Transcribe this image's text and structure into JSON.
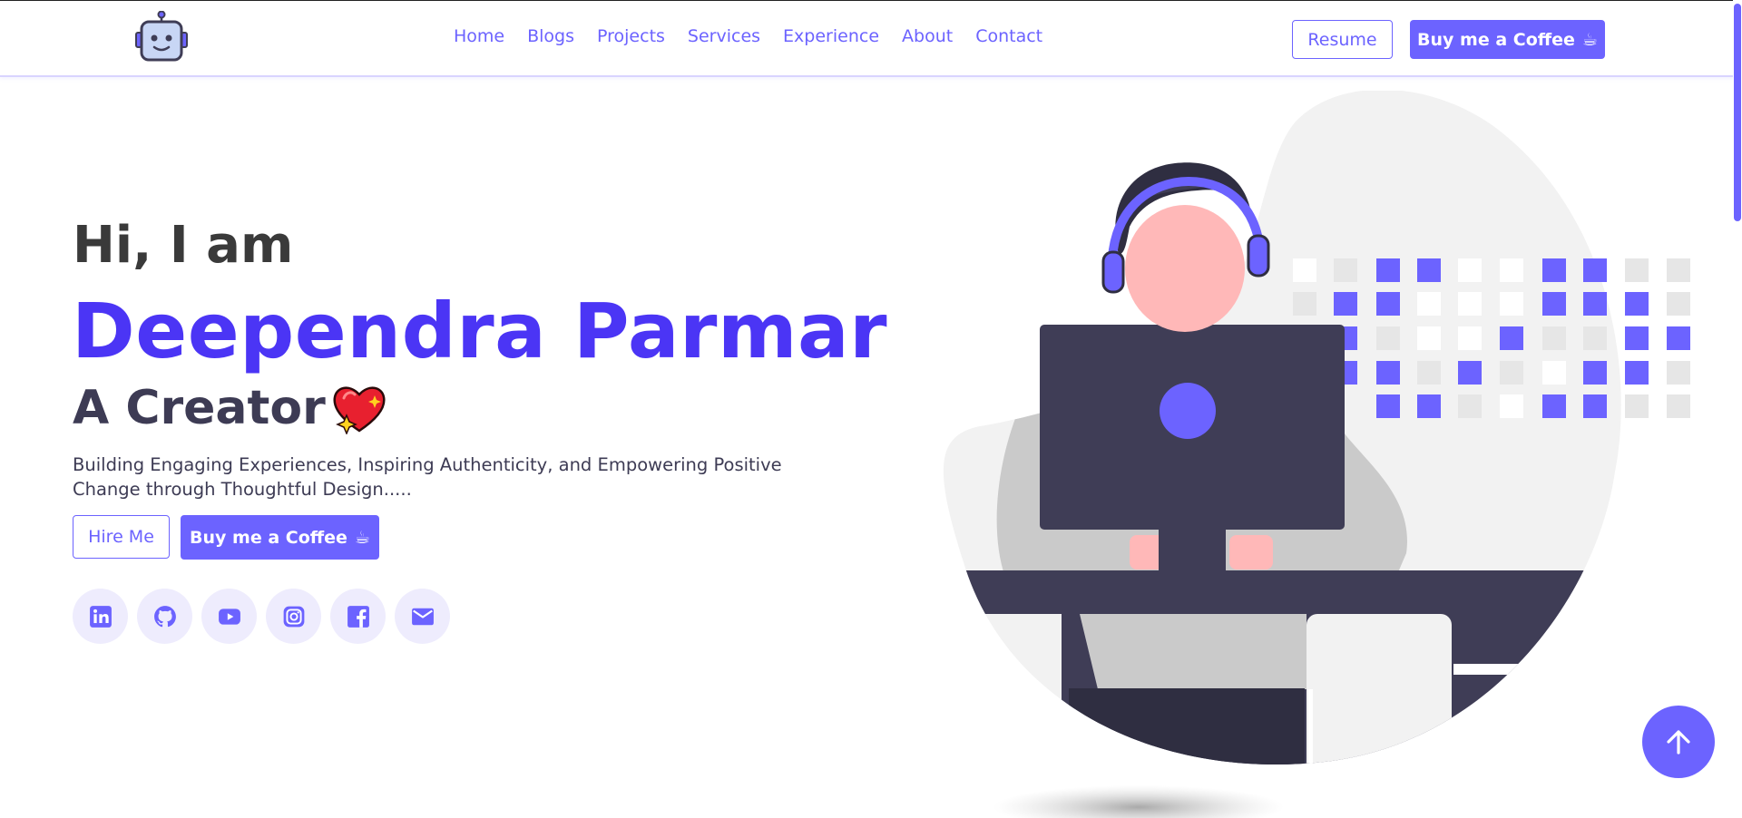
{
  "nav": {
    "links": [
      "Home",
      "Blogs",
      "Projects",
      "Services",
      "Experience",
      "About",
      "Contact"
    ],
    "resume_label": "Resume",
    "coffee_label": "Buy me a Coffee",
    "coffee_emoji": "☕"
  },
  "hero": {
    "greeting": "Hi, I am",
    "name": "Deependra Parmar",
    "role": "A Creator",
    "tagline": "Building Engaging Experiences, Inspiring Authenticity, and Empowering Positive Change through Thoughtful Design.....",
    "hire_label": "Hire Me",
    "coffee_label": "Buy me a Coffee",
    "coffee_emoji": "☕"
  },
  "socials": [
    {
      "icon": "linkedin-icon"
    },
    {
      "icon": "github-icon"
    },
    {
      "icon": "youtube-icon"
    },
    {
      "icon": "instagram-icon"
    },
    {
      "icon": "facebook-icon"
    },
    {
      "icon": "mail-icon"
    }
  ],
  "colors": {
    "accent": "#6c63ff",
    "name": "#4b35f5",
    "dark": "#3f3d56",
    "social_bg": "#eeecfd"
  }
}
